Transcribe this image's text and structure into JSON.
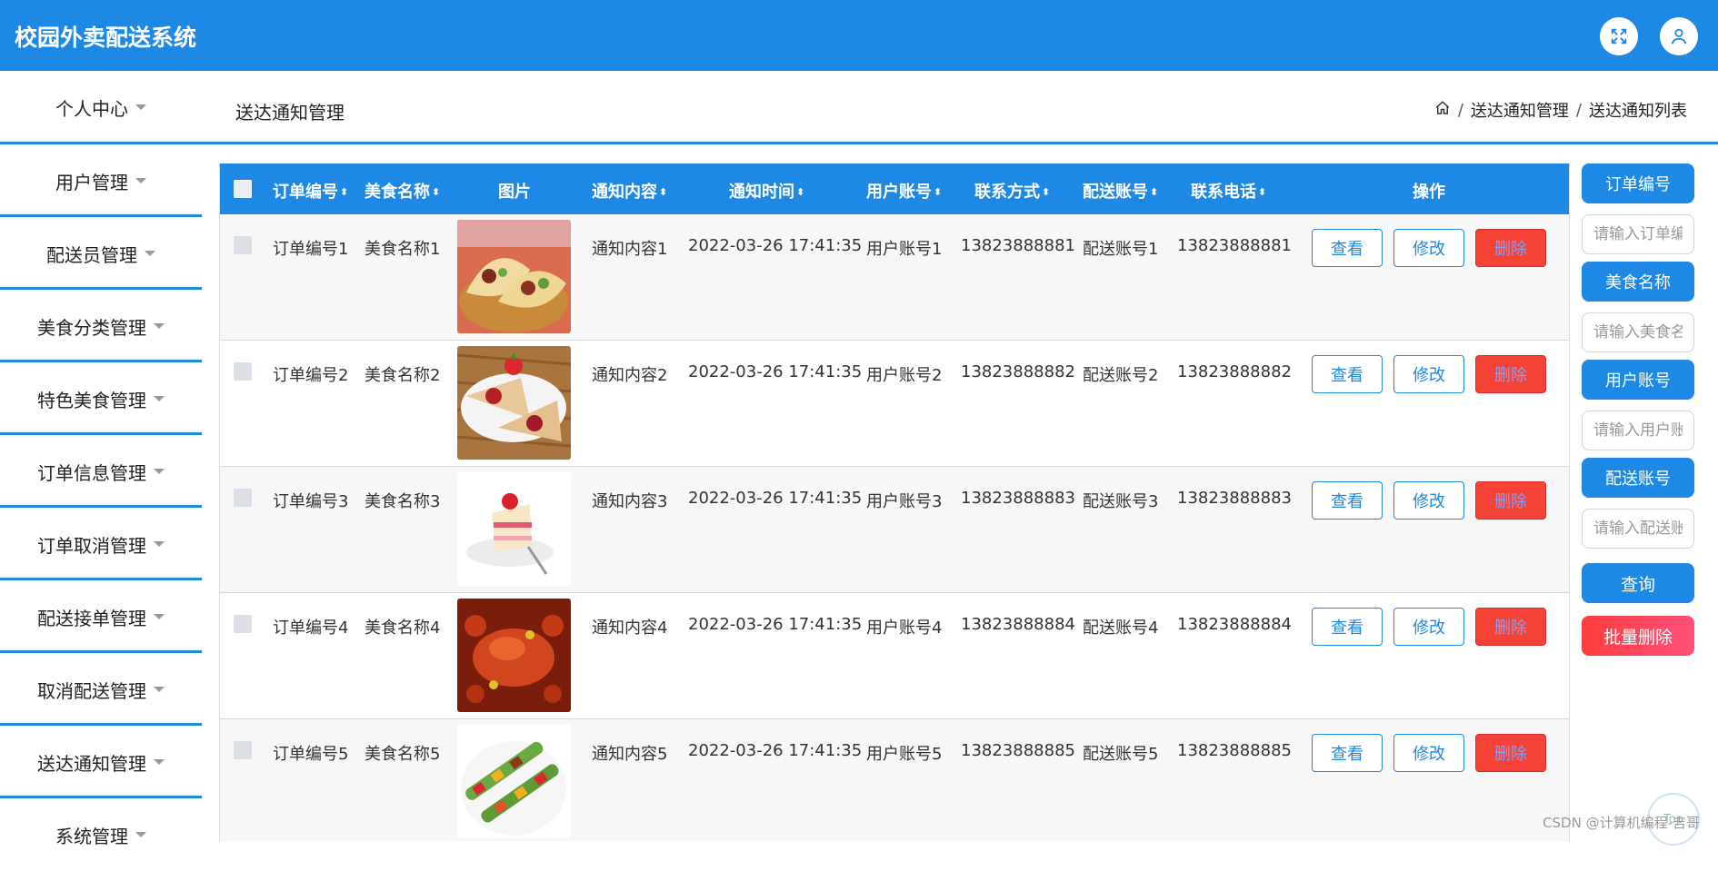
{
  "app": {
    "title": "校园外卖配送系统"
  },
  "topbar": {
    "fullscreen_icon": "expand-icon",
    "user_icon": "user-icon"
  },
  "header": {
    "page_title": "送达通知管理"
  },
  "breadcrumb": {
    "home_icon": "home-icon",
    "items": [
      "送达通知管理",
      "送达通知列表"
    ],
    "separator": "/"
  },
  "sidebar": {
    "items": [
      {
        "label": "个人中心"
      },
      {
        "label": "用户管理"
      },
      {
        "label": "配送员管理"
      },
      {
        "label": "美食分类管理"
      },
      {
        "label": "特色美食管理"
      },
      {
        "label": "订单信息管理"
      },
      {
        "label": "订单取消管理"
      },
      {
        "label": "配送接单管理"
      },
      {
        "label": "取消配送管理"
      },
      {
        "label": "送达通知管理"
      },
      {
        "label": "系统管理"
      }
    ]
  },
  "table": {
    "headers": {
      "order_no": "订单编号",
      "food_name": "美食名称",
      "image": "图片",
      "notice_content": "通知内容",
      "notice_time": "通知时间",
      "user_account": "用户账号",
      "contact": "联系方式",
      "delivery_account": "配送账号",
      "phone": "联系电话",
      "actions": "操作"
    },
    "actions": {
      "view": "查看",
      "edit": "修改",
      "delete": "删除"
    },
    "rows": [
      {
        "order_no": "订单编号1",
        "food_name": "美食名称1",
        "image": "tacos",
        "notice_content": "通知内容1",
        "notice_time": "2022-03-26 17:41:35",
        "user_account": "用户账号1",
        "contact": "13823888881",
        "delivery_account": "配送账号1",
        "phone": "13823888881"
      },
      {
        "order_no": "订单编号2",
        "food_name": "美食名称2",
        "image": "crepes",
        "notice_content": "通知内容2",
        "notice_time": "2022-03-26 17:41:35",
        "user_account": "用户账号2",
        "contact": "13823888882",
        "delivery_account": "配送账号2",
        "phone": "13823888882"
      },
      {
        "order_no": "订单编号3",
        "food_name": "美食名称3",
        "image": "cake",
        "notice_content": "通知内容3",
        "notice_time": "2022-03-26 17:41:35",
        "user_account": "用户账号3",
        "contact": "13823888883",
        "delivery_account": "配送账号3",
        "phone": "13823888883"
      },
      {
        "order_no": "订单编号4",
        "food_name": "美食名称4",
        "image": "crab",
        "notice_content": "通知内容4",
        "notice_time": "2022-03-26 17:41:35",
        "user_account": "用户账号4",
        "contact": "13823888884",
        "delivery_account": "配送账号4",
        "phone": "13823888884"
      },
      {
        "order_no": "订单编号5",
        "food_name": "美食名称5",
        "image": "skewers",
        "notice_content": "通知内容5",
        "notice_time": "2022-03-26 17:41:35",
        "user_account": "用户账号5",
        "contact": "13823888885",
        "delivery_account": "配送账号5",
        "phone": "13823888885"
      }
    ]
  },
  "search": {
    "order_label": "订单编号",
    "order_placeholder": "请输入订单编号",
    "food_label": "美食名称",
    "food_placeholder": "请输入美食名称",
    "user_label": "用户账号",
    "user_placeholder": "请输入用户账号",
    "delivery_label": "配送账号",
    "delivery_placeholder": "请输入配送账号",
    "query_button": "查询",
    "batch_delete_button": "批量删除"
  },
  "watermark": "CSDN @计算机编程-吉哥",
  "back_to_top": "Top",
  "colors": {
    "primary": "#1e88e5",
    "danger": "#f44336",
    "header_bg": "#1e88e5"
  }
}
